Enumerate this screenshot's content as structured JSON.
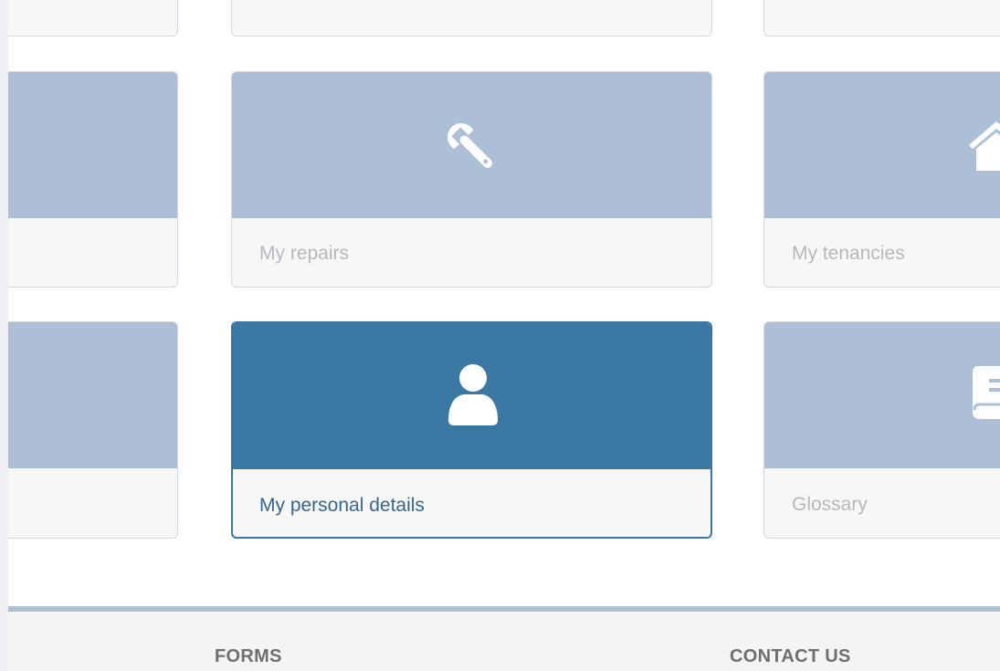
{
  "tiles": [
    {
      "id": "repairs",
      "label": "My repairs",
      "icon": "wrench-icon"
    },
    {
      "id": "tenancies",
      "label": "My tenancies",
      "icon": "house-icon"
    },
    {
      "id": "personal",
      "label": "My personal details",
      "icon": "user-icon",
      "active": true
    },
    {
      "id": "glossary",
      "label": "Glossary",
      "icon": "book-icon"
    }
  ],
  "footer": {
    "forms_label": "FORMS",
    "contact_label": "CONTACT US"
  },
  "colors": {
    "tile_top": "#acbfd6",
    "tile_active": "#3b77a3",
    "tile_bottom": "#f7f7f7",
    "footer_divider": "#aec0d4"
  }
}
